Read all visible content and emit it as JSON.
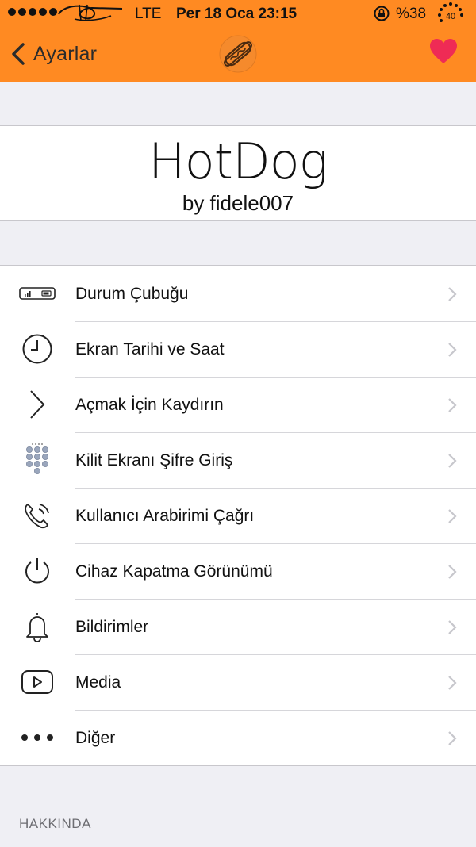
{
  "status_bar": {
    "network": "LTE",
    "datetime": "Per 18 Oca 23:15",
    "battery": "%38",
    "ring_value": "40"
  },
  "nav": {
    "back_label": "Ayarlar",
    "center_icon": "hotdog-icon",
    "right_icon": "heart-icon"
  },
  "header": {
    "title": "HotDog",
    "subtitle": "by fidele007"
  },
  "menu": {
    "items": [
      {
        "label": "Durum Çubuğu",
        "icon": "status-bar-icon"
      },
      {
        "label": "Ekran Tarihi ve Saat",
        "icon": "clock-icon"
      },
      {
        "label": "Açmak İçin Kaydırın",
        "icon": "chevron-right-icon"
      },
      {
        "label": "Kilit Ekranı Şifre Giriş",
        "icon": "keypad-icon"
      },
      {
        "label": "Kullanıcı Arabirimi Çağrı",
        "icon": "phone-call-icon"
      },
      {
        "label": "Cihaz Kapatma Görünümü",
        "icon": "power-icon"
      },
      {
        "label": "Bildirimler",
        "icon": "bell-icon"
      },
      {
        "label": "Media",
        "icon": "play-icon"
      },
      {
        "label": "Diğer",
        "icon": "more-dots-icon"
      }
    ]
  },
  "sections": {
    "about": "HAKKINDA"
  },
  "colors": {
    "nav_background": "#ff8a22",
    "heart": "#ef2b55",
    "page_background": "#efeff4"
  }
}
